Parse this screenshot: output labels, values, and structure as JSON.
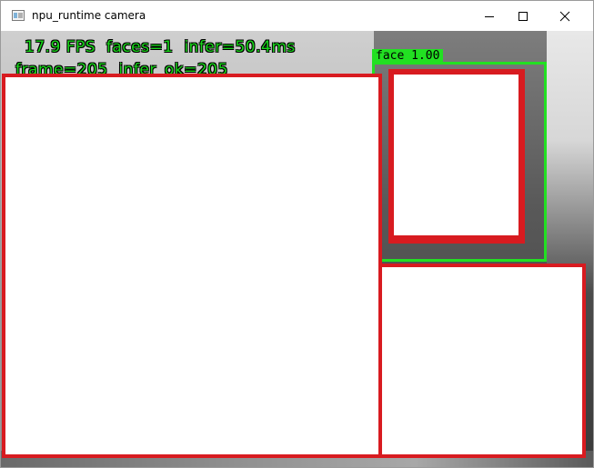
{
  "window": {
    "title": "npu_runtime camera",
    "icon": "app-window-icon",
    "controls": [
      "minimize-icon",
      "maximize-icon",
      "close-icon"
    ]
  },
  "overlay": {
    "line1": "17.9 FPS  faces=1  infer=50.4ms",
    "line2": "frame=205  infer_ok=205",
    "text_color": "#18d61a"
  },
  "detection": {
    "label": "face 1.00",
    "box_color": "#22e022"
  },
  "redaction": {
    "color": "#d81b20"
  }
}
